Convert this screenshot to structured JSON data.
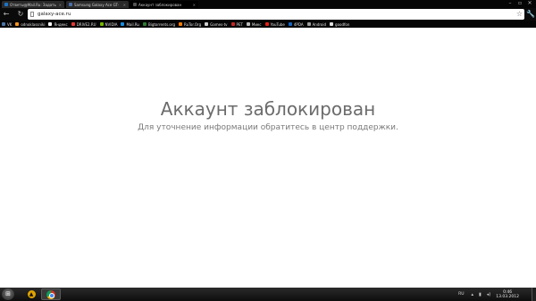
{
  "browser": {
    "tabs": [
      {
        "title": "Ответы@Mail.Ru: Задать в",
        "favicon_color": "#1e73c8",
        "active": false
      },
      {
        "title": "Samsung Galaxy Ace GT-",
        "favicon_color": "#4a6ea8",
        "active": false
      },
      {
        "title": "Аккаунт заблокирован",
        "favicon_color": "#555555",
        "active": true
      }
    ],
    "address": "galaxy-ace.ru",
    "bookmarks": [
      {
        "label": "VK",
        "color": "#4a76a8"
      },
      {
        "label": "odnoklassniki",
        "color": "#f79520"
      },
      {
        "label": "Яндекс",
        "color": "#ffffff"
      },
      {
        "label": "DRIVE2.RU",
        "color": "#e53935"
      },
      {
        "label": "NVIDIA",
        "color": "#76b900"
      },
      {
        "label": "Mail.Ru",
        "color": "#168de2"
      },
      {
        "label": "Bigtorrents.org",
        "color": "#2e7d32"
      },
      {
        "label": "RuTor.Org",
        "color": "#f57c00"
      },
      {
        "label": "Games-tv",
        "color": "#cfcfcf"
      },
      {
        "label": "PET",
        "color": "#c62828"
      },
      {
        "label": "Микс",
        "color": "#bbbbbb"
      },
      {
        "label": "YouTube",
        "color": "#e62117"
      },
      {
        "label": "4PDA",
        "color": "#1565c0"
      },
      {
        "label": "Android",
        "color": "#9e9e9e"
      },
      {
        "label": "goodfon",
        "color": "#e0e0e0"
      }
    ]
  },
  "page": {
    "heading": "Аккаунт заблокирован",
    "message": "Для уточнение информации обратитесь в центр поддержки."
  },
  "taskbar": {
    "language": "RU",
    "time": "0:46",
    "date": "13.03.2012"
  }
}
